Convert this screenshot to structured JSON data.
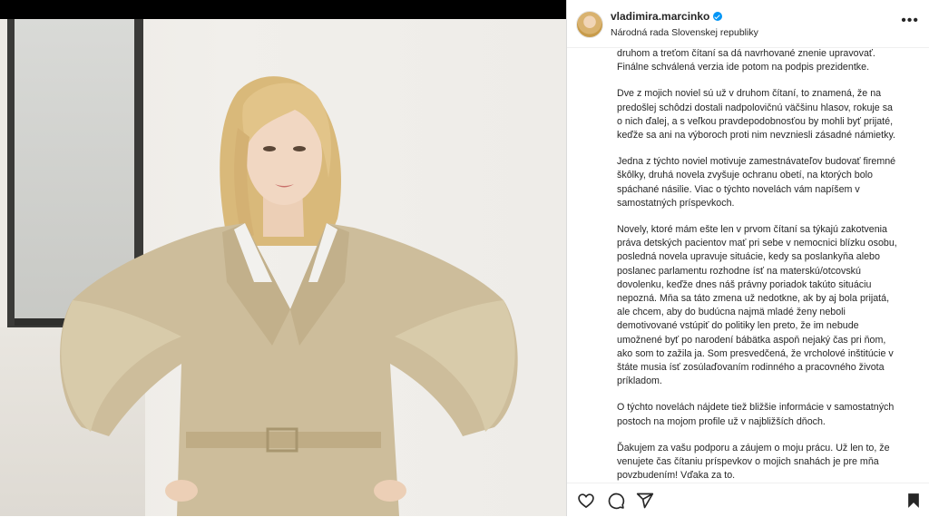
{
  "post": {
    "username": "vladimira.marcinko",
    "subtitle": "Národná rada Slovenskej republiky",
    "more_label": "•••",
    "caption": [
      "druhom a treťom čítaní sa dá navrhované znenie upravovať.\nFinálne schválená verzia ide potom na podpis prezidentke.",
      "Dve z mojich noviel sú už v druhom čítaní, to znamená, že na\npredošlej schôdzi dostali nadpolovičnú väčšinu hlasov, rokuje sa\no nich ďalej, a s veľkou pravdepodobnosťou by mohli byť prijaté,\nkeďže sa ani na výboroch proti nim nevzniesli zásadné námietky.",
      "Jedna z týchto noviel motivuje zamestnávateľov budovať firemné\nškôlky, druhá novela zvyšuje ochranu obetí, na ktorých bolo\nspáchané násilie. Viac o týchto novelách vám napíšem v\nsamostatných príspevkoch.",
      "Novely, ktoré mám ešte len v prvom čítaní sa týkajú zakotvenia\npráva detských pacientov mať pri sebe v nemocnici blízku osobu,\nposledná novela upravuje situácie, kedy sa poslankyňa alebo\nposlanec parlamentu rozhodne ísť na materskú/otcovskú\ndovolenku, keďže dnes náš právny poriadok takúto situáciu\nnepozná. Mňa sa táto zmena už nedotkne, ak by aj bola prijatá,\nale chcem, aby do budúcna najmä mladé ženy neboli\ndemotivované vstúpiť do politiky len preto, že im nebude\numožnené byť po narodení bábätka aspoň nejaký čas pri ňom,\nako som to zažila ja. Som presvedčená, že vrcholové inštitúcie v\nštáte musia ísť zosúlaďovaním rodinného a pracovného života\npríkladom.",
      "O týchto novelách nájdete tiež bližšie informácie v samostatných\npostoch na mojom profile už v najbližších dňoch.",
      "Ďakujem za vašu podporu a záujem o moju prácu. Už len to, že\nvenujete čas čítaniu príspevkov o mojich snahách je pre mňa\npovzbudením! Vďaka za to."
    ]
  },
  "icons": {
    "like": "heart-icon",
    "comment": "comment-icon",
    "share": "share-icon",
    "save": "bookmark-icon",
    "verified": "verified-badge-icon"
  },
  "colors": {
    "verified": "#0095f6",
    "text": "#262626",
    "coat": "#cdbd9b"
  }
}
